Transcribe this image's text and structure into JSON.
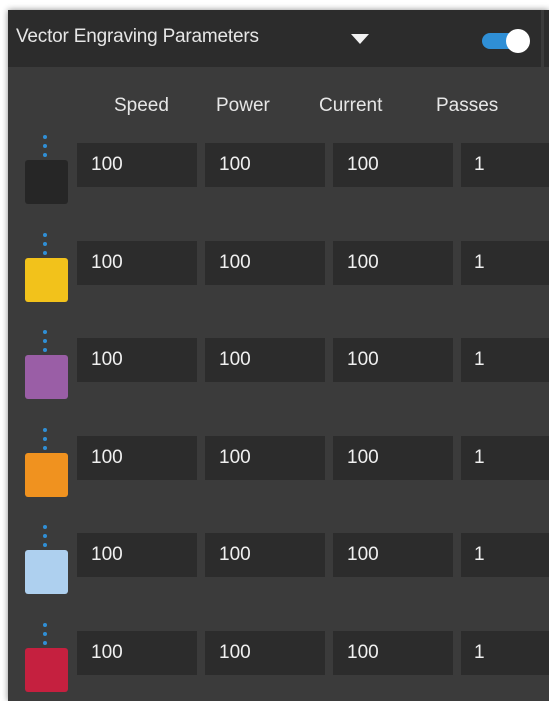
{
  "header": {
    "title": "Vector Engraving Parameters",
    "caret_icon": "caret-down-icon",
    "toggle_state": "on",
    "toggle_color": "#2f8fd6"
  },
  "columns": {
    "speed": "Speed",
    "power": "Power",
    "current": "Current",
    "passes": "Passes"
  },
  "rows": [
    {
      "color": "#262626",
      "speed": "100",
      "power": "100",
      "current": "100",
      "passes": "1"
    },
    {
      "color": "#f2c21b",
      "speed": "100",
      "power": "100",
      "current": "100",
      "passes": "1"
    },
    {
      "color": "#9a5ea6",
      "speed": "100",
      "power": "100",
      "current": "100",
      "passes": "1"
    },
    {
      "color": "#f0921f",
      "speed": "100",
      "power": "100",
      "current": "100",
      "passes": "1"
    },
    {
      "color": "#aed0ef",
      "speed": "100",
      "power": "100",
      "current": "100",
      "passes": "1"
    },
    {
      "color": "#c5203f",
      "speed": "100",
      "power": "100",
      "current": "100",
      "passes": "1"
    }
  ],
  "theme": {
    "panel_bg": "#3b3b3b",
    "field_bg": "#2c2c2c",
    "handle_color": "#2f8fd6"
  }
}
